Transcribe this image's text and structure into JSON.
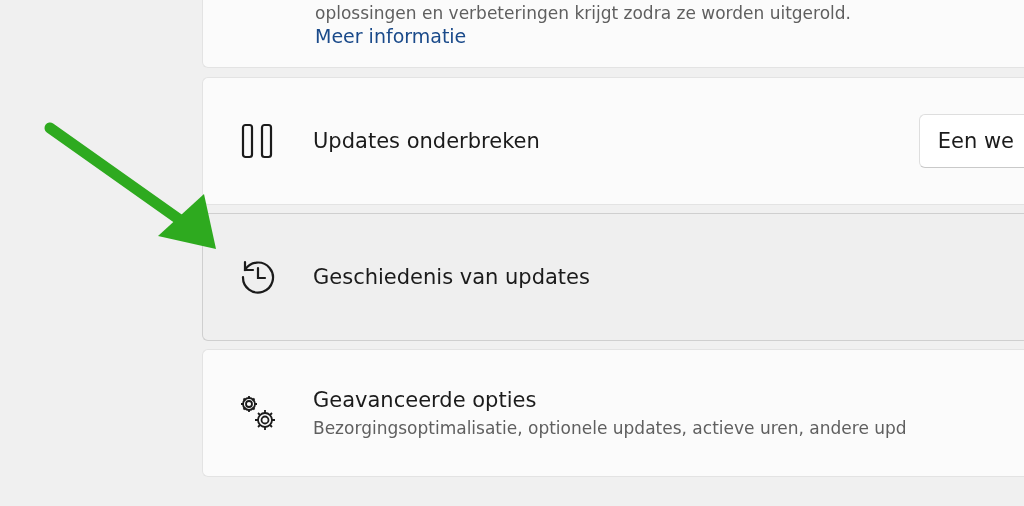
{
  "top_card": {
    "description": "oplossingen en verbeteringen krijgt zodra ze worden uitgerold.",
    "link": "Meer informatie"
  },
  "rows": [
    {
      "kind": "pause",
      "title": "Updates onderbreken",
      "button": "Een we",
      "highlighted": false
    },
    {
      "kind": "history",
      "title": "Geschiedenis van updates",
      "highlighted": true
    },
    {
      "kind": "advanced",
      "title": "Geavanceerde opties",
      "subtitle": "Bezorgingsoptimalisatie, optionele updates, actieve uren, andere upd",
      "highlighted": false
    }
  ]
}
